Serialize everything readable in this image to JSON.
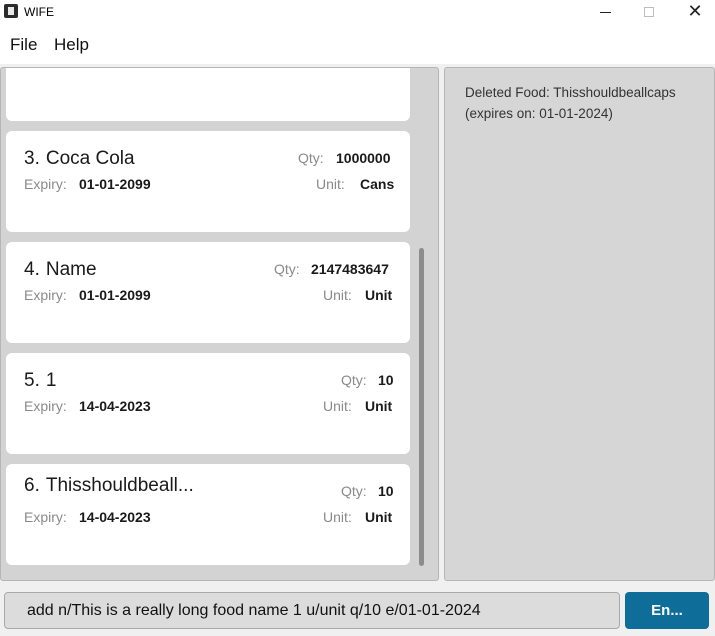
{
  "window": {
    "title": "WIFE",
    "icon": "app-icon",
    "close_glyph": "✕"
  },
  "menu": {
    "file": "File",
    "help": "Help"
  },
  "labels": {
    "qty": "Qty:",
    "unit": "Unit:",
    "expiry": "Expiry:"
  },
  "food_list": [
    {
      "index": "3.",
      "name": "Coca Cola",
      "qty": "1000000",
      "expiry": "01-01-2099",
      "unit": "Cans"
    },
    {
      "index": "4.",
      "name": "Name",
      "qty": "2147483647",
      "expiry": "01-01-2099",
      "unit": "Unit"
    },
    {
      "index": "5.",
      "name": "1",
      "qty": "10",
      "expiry": "14-04-2023",
      "unit": "Unit"
    },
    {
      "index": "6.",
      "name": "Thisshouldbeall...",
      "qty": "10",
      "expiry": "14-04-2023",
      "unit": "Unit"
    }
  ],
  "result": {
    "message": "Deleted Food: Thisshouldbeallcaps (expires on: 01-01-2024)"
  },
  "command": {
    "value": "add n/This is a really long food name 1 u/unit q/10 e/01-01-2024",
    "enter_label": "En..."
  },
  "colors": {
    "accent": "#0e6e99",
    "panel_bg": "#d3d3d3",
    "card_bg": "#ffffff"
  }
}
